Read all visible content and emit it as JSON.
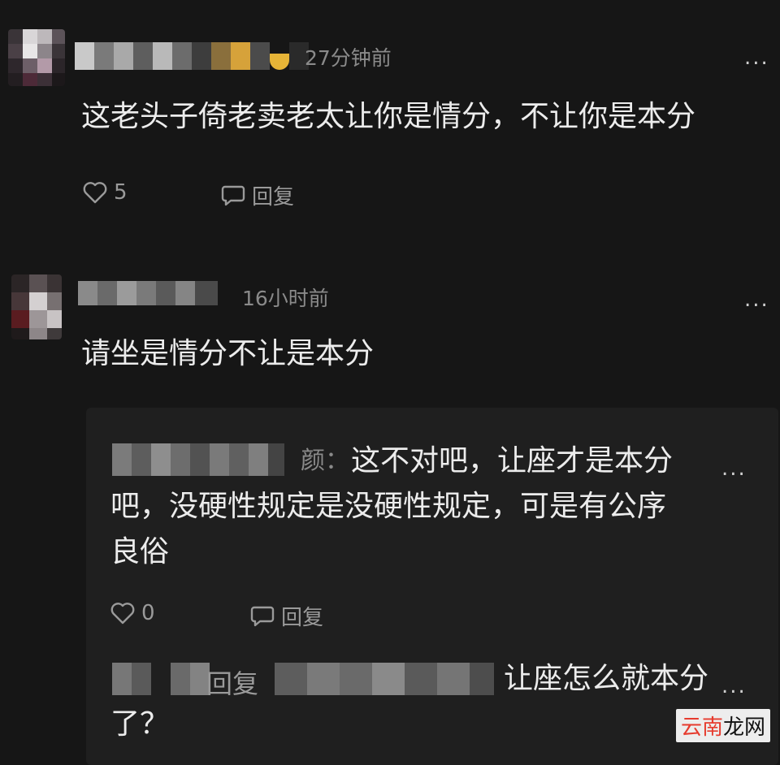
{
  "comments": [
    {
      "time": "27分钟前",
      "text": "这老头子倚老卖老太让你是情分，不让你是本分",
      "likes": "5",
      "reply_label": "回复",
      "more": "..."
    },
    {
      "time": "16小时前",
      "text": "请坐是情分不让是本分",
      "more": "..."
    }
  ],
  "replies": [
    {
      "author_suffix": "颜：",
      "lines": [
        "这不对吧，让座才是本分",
        "吧，没硬性规定是没硬性规定，可是有公序",
        "良俗"
      ],
      "likes": "0",
      "reply_label": "回复",
      "more": "..."
    },
    {
      "reply_word": "回复",
      "text_line1": "让座怎么就本分",
      "text_line2": "了？",
      "more": "..."
    }
  ],
  "watermark": {
    "part1": "云南",
    "part2": "龙网"
  },
  "icons": {
    "like": "heart-outline-icon",
    "reply": "speech-bubble-icon",
    "more": "more-dots-icon"
  },
  "colors": {
    "background": "#161616",
    "reply_box": "#1f1f1f",
    "text": "#ececec",
    "muted": "#8a8a8a",
    "watermark_red": "#e63b2e"
  }
}
